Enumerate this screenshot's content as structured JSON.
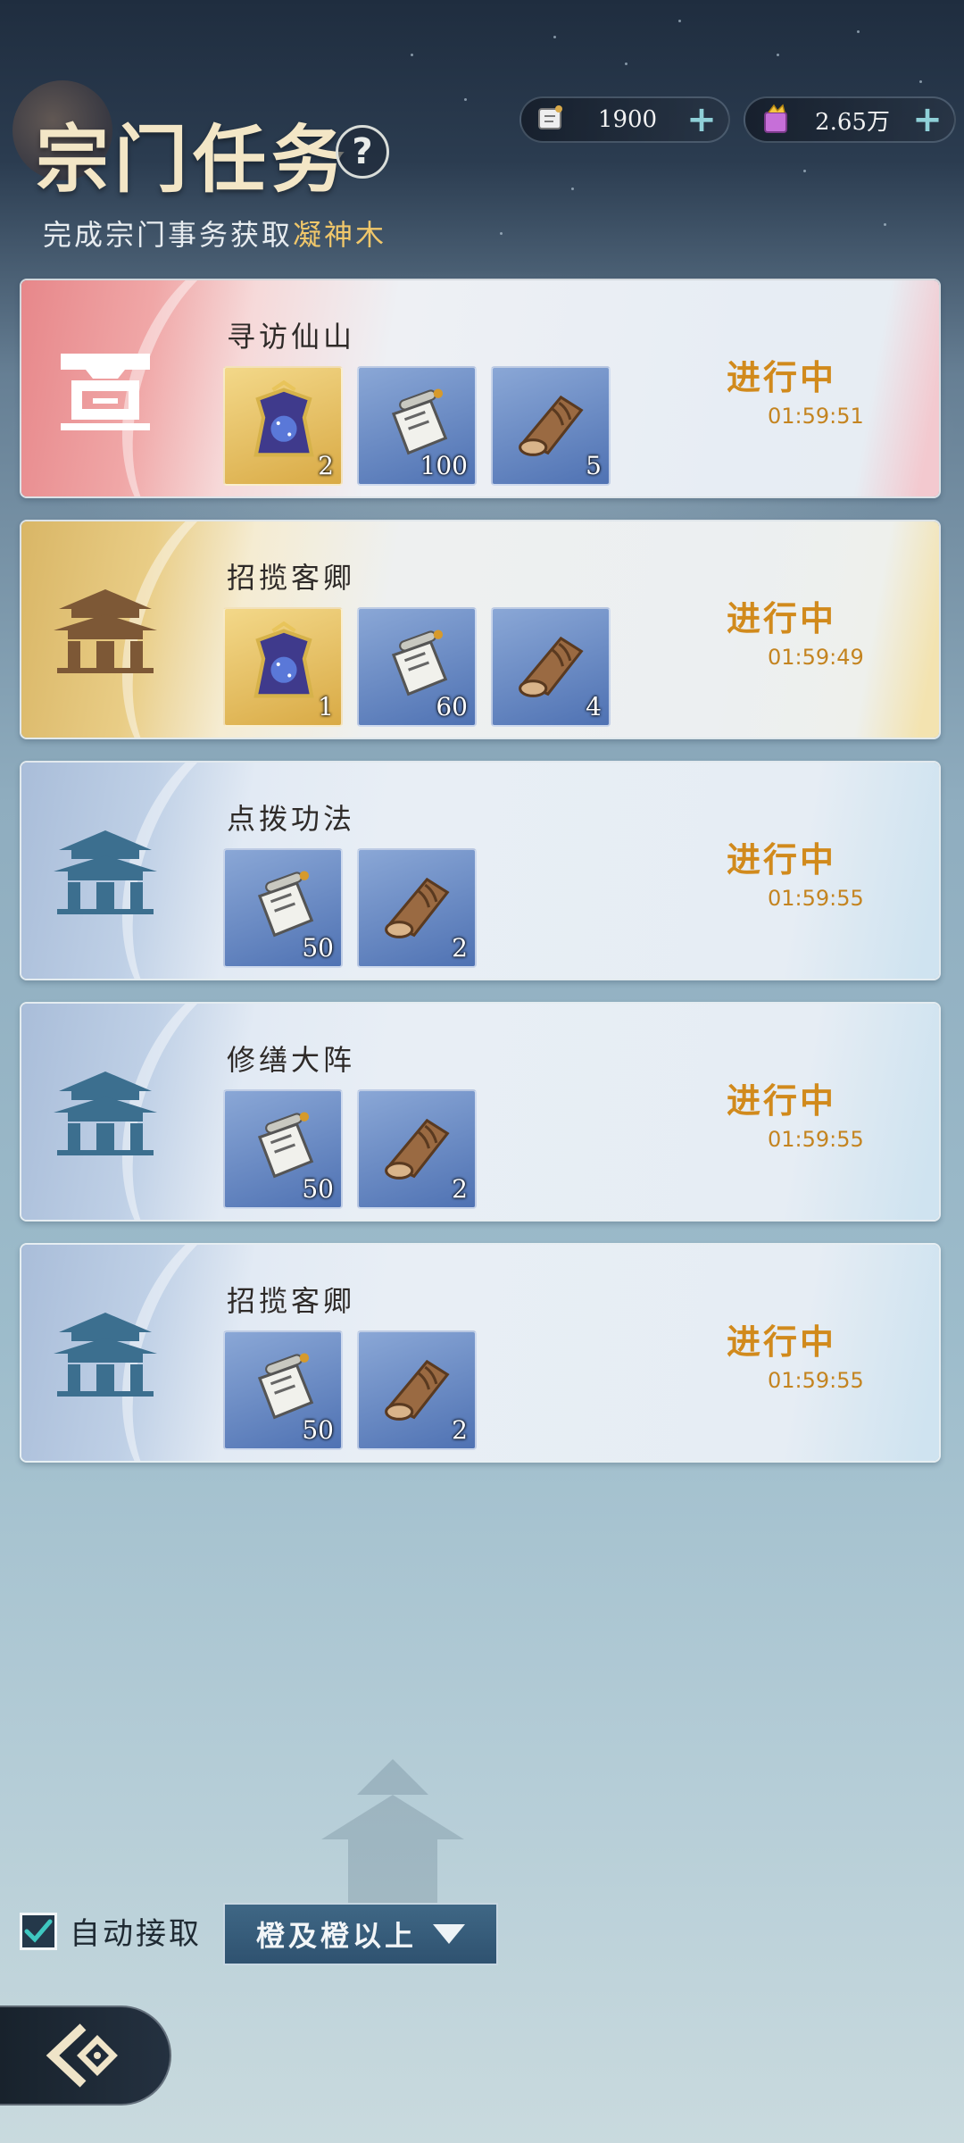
{
  "header": {
    "title": "宗门任务",
    "help_label": "?",
    "subtitle_prefix": "完成宗门事务获取",
    "subtitle_highlight": "凝神木"
  },
  "resources": [
    {
      "name": "scroll-currency",
      "value": "1900",
      "plus": "+"
    },
    {
      "name": "gem-currency",
      "value": "2.65万",
      "plus": "+"
    }
  ],
  "tasks": [
    {
      "name": "寻访仙山",
      "theme": "red",
      "status": "进行中",
      "timer": "01:59:51",
      "rewards": [
        {
          "icon": "robe-icon",
          "qty": "2"
        },
        {
          "icon": "scroll-icon",
          "qty": "100"
        },
        {
          "icon": "wood-icon",
          "qty": "5"
        }
      ]
    },
    {
      "name": "招揽客卿",
      "theme": "gold",
      "status": "进行中",
      "timer": "01:59:49",
      "rewards": [
        {
          "icon": "robe-icon",
          "qty": "1"
        },
        {
          "icon": "scroll-icon",
          "qty": "60"
        },
        {
          "icon": "wood-icon",
          "qty": "4"
        }
      ]
    },
    {
      "name": "点拨功法",
      "theme": "blue",
      "status": "进行中",
      "timer": "01:59:55",
      "rewards": [
        {
          "icon": "scroll-icon",
          "qty": "50"
        },
        {
          "icon": "wood-icon",
          "qty": "2"
        }
      ]
    },
    {
      "name": "修缮大阵",
      "theme": "blue",
      "status": "进行中",
      "timer": "01:59:55",
      "rewards": [
        {
          "icon": "scroll-icon",
          "qty": "50"
        },
        {
          "icon": "wood-icon",
          "qty": "2"
        }
      ]
    },
    {
      "name": "招揽客卿",
      "theme": "blue",
      "status": "进行中",
      "timer": "01:59:55",
      "rewards": [
        {
          "icon": "scroll-icon",
          "qty": "50"
        },
        {
          "icon": "wood-icon",
          "qty": "2"
        }
      ]
    }
  ],
  "footer": {
    "auto_accept_label": "自动接取",
    "auto_accept_checked": true,
    "filter_value": "橙及橙以上"
  },
  "colors": {
    "status": "#d18a1c",
    "highlight": "#f0c76a"
  }
}
